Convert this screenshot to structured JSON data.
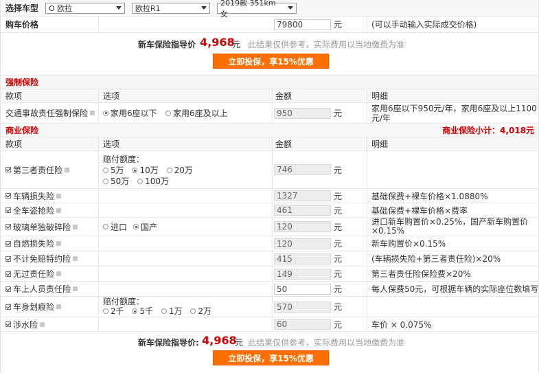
{
  "top": {
    "label": "选择车型",
    "brand": "O 欧拉",
    "series": "欧拉R1",
    "model": "2019款 351km 女"
  },
  "price": {
    "label": "购车价格",
    "value": "79800",
    "unit": "元",
    "hint": "(可以手动输入实际成交价格)"
  },
  "guide_top": {
    "label": "新车保险指导价",
    "value": "4,968",
    "unit": "元",
    "note": "此结果仅供参考，实际费用以当地缴费为准",
    "button": "立即投保，享15%优惠"
  },
  "compulsory": {
    "title": "强制保险",
    "headers": [
      "款项",
      "选项",
      "金额",
      "明细"
    ],
    "row": {
      "name": "交通事故责任强制保险",
      "opt1": "家用6座以下",
      "opt2": "家用6座及以上",
      "amount": "950",
      "unit": "元",
      "detail_1": "家用6座以下950元/年，家用6座及以上1100",
      "detail_2": "元/年"
    }
  },
  "commercial": {
    "title": "商业保险",
    "subtotal": "商业保险小计：4,018元",
    "headers": [
      "款项",
      "选项",
      "金额",
      "明细"
    ],
    "third_party": {
      "name": "第三者责任险",
      "opt_label": "赔付额度：",
      "opts": [
        "5万",
        "10万",
        "20万",
        "50万",
        "100万"
      ],
      "amount": "746",
      "unit": "元"
    },
    "rows": [
      {
        "name": "车辆损失险",
        "amount": "1327",
        "unit": "元",
        "detail": "基础保费+裸车价格×1.0880%"
      },
      {
        "name": "全车盗抢险",
        "amount": "461",
        "unit": "元",
        "detail": "基础保费+裸车价格×费率"
      }
    ],
    "glass": {
      "name": "玻璃单独破碎险",
      "opt1": "进口",
      "opt2": "国产",
      "amount": "120",
      "unit": "元",
      "detail_1": "进口新车购置价×0.25%，国产新车购置价",
      "detail_2": "×0.15%"
    },
    "rows2": [
      {
        "name": "自燃损失险",
        "amount": "120",
        "unit": "元",
        "detail": "新车购置价×0.15%"
      },
      {
        "name": "不计免赔特约险",
        "amount": "415",
        "unit": "元",
        "detail": "(车辆损失险+第三者责任险)×20%"
      },
      {
        "name": "无过责任险",
        "amount": "149",
        "unit": "元",
        "detail": "第三者责任险保险费×20%"
      },
      {
        "name": "车上人员责任险",
        "amount": "50",
        "unit": "元",
        "detail": "每人保费50元，可根据车辆的实际座位数填写"
      }
    ],
    "scratch": {
      "name": "车身划痕险",
      "opt_label": "赔付额度：",
      "opts": [
        "2千",
        "5千",
        "1万",
        "2万"
      ],
      "amount": "570",
      "unit": "元"
    },
    "wading": {
      "name": "涉水险",
      "amount": "60",
      "unit": "元",
      "detail": "车价 × 0.075%"
    }
  },
  "guide_bottom": {
    "label": "新车保险指导价:",
    "value": "4,968",
    "unit": "元",
    "note": "此结果仅供参考，实际费用以当地缴费为准",
    "button": "立即投保，享15%优惠"
  }
}
